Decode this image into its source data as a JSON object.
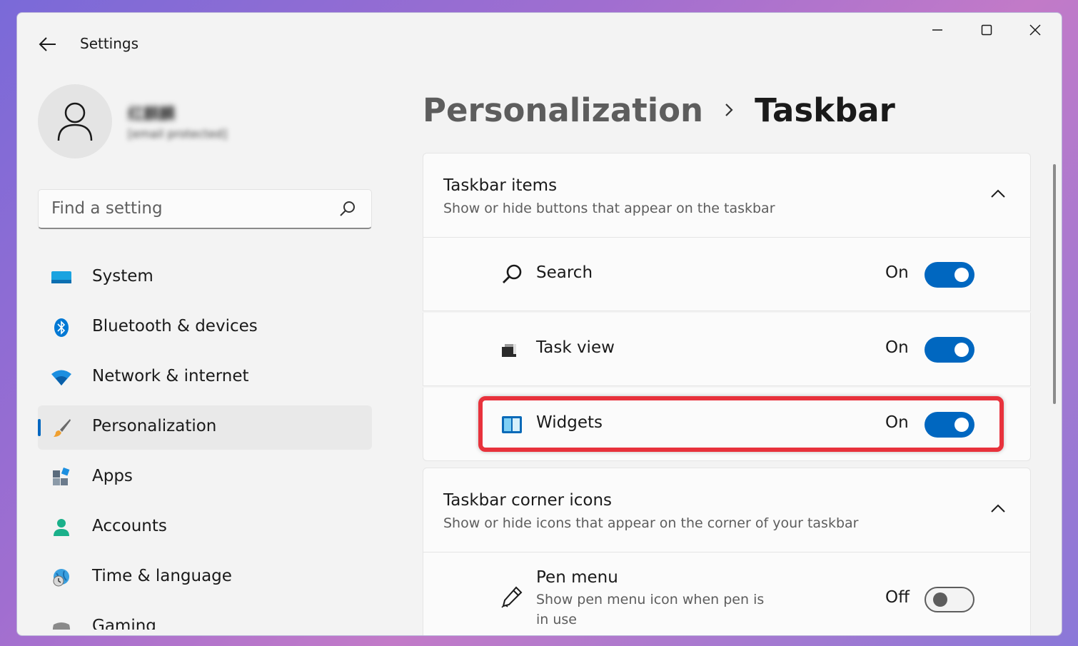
{
  "window": {
    "title": "Settings"
  },
  "user": {
    "name": "红麒麟",
    "email": "[email protected]"
  },
  "search": {
    "placeholder": "Find a setting"
  },
  "nav": {
    "items": [
      {
        "label": "System",
        "icon": "system-icon"
      },
      {
        "label": "Bluetooth & devices",
        "icon": "bluetooth-icon"
      },
      {
        "label": "Network & internet",
        "icon": "wifi-icon"
      },
      {
        "label": "Personalization",
        "icon": "paintbrush-icon",
        "selected": true
      },
      {
        "label": "Apps",
        "icon": "apps-icon"
      },
      {
        "label": "Accounts",
        "icon": "accounts-icon"
      },
      {
        "label": "Time & language",
        "icon": "globe-clock-icon"
      },
      {
        "label": "Gaming",
        "icon": "gaming-icon"
      }
    ]
  },
  "breadcrumb": {
    "parent": "Personalization",
    "current": "Taskbar"
  },
  "taskbar_items": {
    "title": "Taskbar items",
    "subtitle": "Show or hide buttons that appear on the taskbar",
    "rows": [
      {
        "label": "Search",
        "state": "On",
        "icon": "search-icon"
      },
      {
        "label": "Task view",
        "state": "On",
        "icon": "task-view-icon"
      },
      {
        "label": "Widgets",
        "state": "On",
        "icon": "widgets-icon"
      }
    ]
  },
  "corner_icons": {
    "title": "Taskbar corner icons",
    "subtitle": "Show or hide icons that appear on the corner of your taskbar",
    "rows": [
      {
        "label": "Pen menu",
        "description": "Show pen menu icon when pen is in use",
        "state": "Off",
        "icon": "pen-icon"
      }
    ]
  },
  "colors": {
    "accent": "#0067c0",
    "highlight": "#e8323c",
    "background": "#f3f3f3"
  }
}
